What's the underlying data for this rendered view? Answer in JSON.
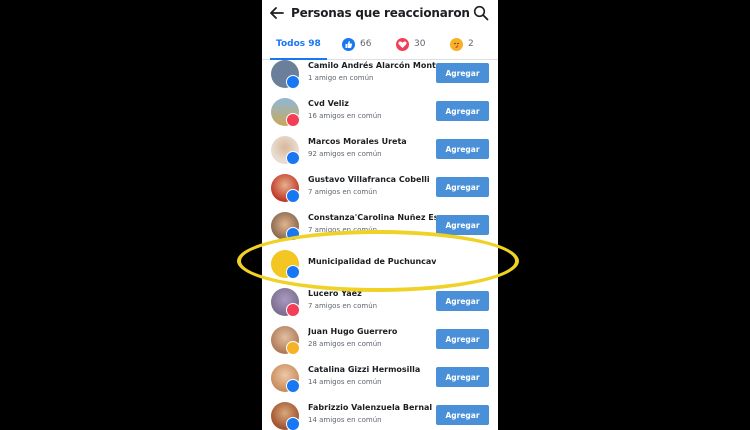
{
  "header": {
    "title": "Personas que reaccionaron"
  },
  "tabs": {
    "all_label": "Todos 98",
    "like_count": "66",
    "love_count": "30",
    "care_count": "2"
  },
  "people": [
    {
      "name": "Camilo Andrés Alarcón Mont…",
      "mutual": "1 amigo en común",
      "reaction": "like",
      "avatar_color": "#6b7f9a",
      "add_label": "Agregar"
    },
    {
      "name": "Cvd Veliz",
      "mutual": "16 amigos en común",
      "reaction": "love",
      "avatar_color": "#c9a85a",
      "add_label": "Agregar"
    },
    {
      "name": "Marcos Morales Ureta",
      "mutual": "92 amigos en común",
      "reaction": "like",
      "avatar_color": "#e8dcd0",
      "add_label": "Agregar"
    },
    {
      "name": "Gustavo Villafranca Cobelli",
      "mutual": "7 amigos en común",
      "reaction": "like",
      "avatar_color": "#c0392b",
      "add_label": "Agregar"
    },
    {
      "name": "Constanza'Carolina Nuñez Es…",
      "mutual": "7 amigos en común",
      "reaction": "like",
      "avatar_color": "#8a6a4f",
      "add_label": "Agregar"
    },
    {
      "name": "Municipalidad de Puchuncaví",
      "mutual": "",
      "reaction": "like",
      "avatar_color": "#f3c623",
      "add_label": ""
    },
    {
      "name": "Lucero Yáez",
      "mutual": "7 amigos en común",
      "reaction": "love",
      "avatar_color": "#7b6e8f",
      "add_label": "Agregar"
    },
    {
      "name": "Juan Hugo Guerrero",
      "mutual": "28 amigos en común",
      "reaction": "care",
      "avatar_color": "#b07a5a",
      "add_label": "Agregar"
    },
    {
      "name": "Catalina Gizzi Hermosilla",
      "mutual": "14 amigos en común",
      "reaction": "like",
      "avatar_color": "#c98c5c",
      "add_label": "Agregar"
    },
    {
      "name": "Fabrizzio Valenzuela Bernal",
      "mutual": "14 amigos en común",
      "reaction": "like",
      "avatar_color": "#a0522d",
      "add_label": "Agregar"
    }
  ],
  "colors": {
    "accent": "#1877f2",
    "button": "#4a90d9",
    "highlight": "#f0d126"
  }
}
